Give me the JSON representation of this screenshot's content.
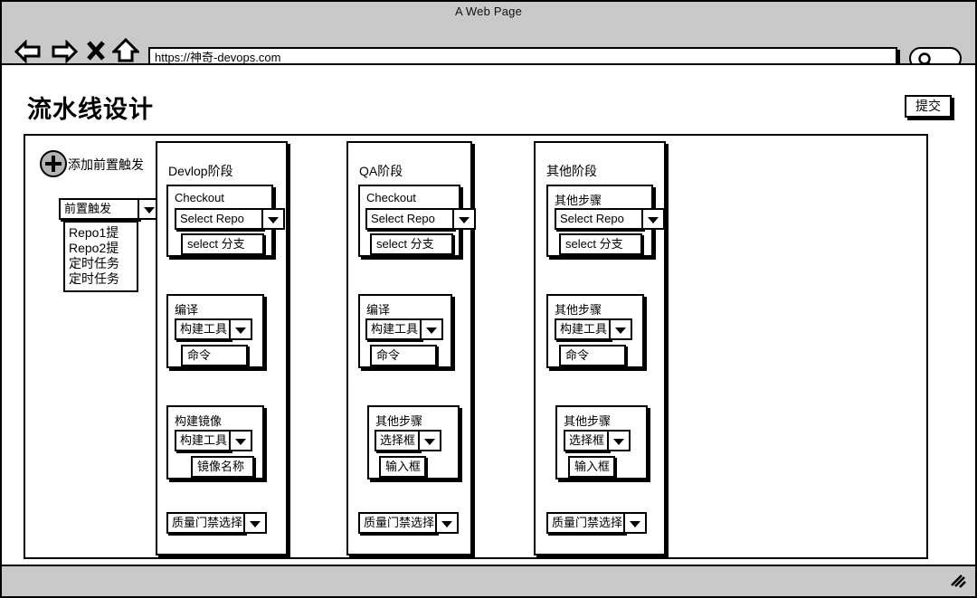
{
  "browser": {
    "window_title": "A Web Page",
    "url": "https://神奇-devops.com",
    "nav": {
      "back_icon": "back-arrow-icon",
      "forward_icon": "forward-arrow-icon",
      "stop_icon": "close-x-icon",
      "home_icon": "home-icon",
      "search_icon": "search-magnifier-icon"
    },
    "status": {
      "resize_grip": "resize-grip-icon"
    }
  },
  "page": {
    "title": "流水线设计",
    "submit_label": "提交"
  },
  "trigger": {
    "add_label": "添加前置触发",
    "plus_icon": "plus-circle-icon",
    "select_value": "前置触发",
    "options": [
      "Repo1提",
      "Repo2提",
      "定时任务",
      "定时任务"
    ]
  },
  "stages": [
    {
      "title": "Devlop阶段",
      "cards": [
        {
          "title": "Checkout",
          "select_value": "Select Repo",
          "input_value": "select 分支"
        },
        {
          "title": "编译",
          "select_value": "构建工具",
          "input_value": "命令"
        },
        {
          "title": "构建镜像",
          "select_value": "构建工具",
          "input_value": "镜像名称"
        }
      ],
      "gate_label": "质量门禁选择"
    },
    {
      "title": "QA阶段",
      "cards": [
        {
          "title": "Checkout",
          "select_value": "Select Repo",
          "input_value": "select 分支"
        },
        {
          "title": "编译",
          "select_value": "构建工具",
          "input_value": "命令"
        },
        {
          "title": "其他步骤",
          "select_value": "选择框",
          "input_value": "输入框"
        }
      ],
      "gate_label": "质量门禁选择"
    },
    {
      "title": "其他阶段",
      "cards": [
        {
          "title": "其他步骤",
          "select_value": "Select Repo",
          "input_value": "select 分支"
        },
        {
          "title": "其他步骤",
          "select_value": "构建工具",
          "input_value": "命令"
        },
        {
          "title": "其他步骤",
          "select_value": "选择框",
          "input_value": "输入框"
        }
      ],
      "gate_label": "质量门禁选择"
    }
  ]
}
